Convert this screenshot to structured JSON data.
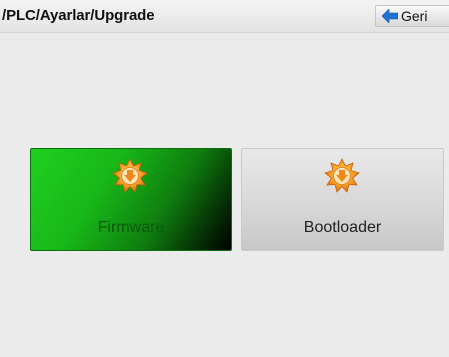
{
  "header": {
    "breadcrumb": "/PLC/Ayarlar/Upgrade",
    "back_label": "Geri",
    "back_icon": "arrow-left-icon"
  },
  "tiles": [
    {
      "label": "Firmware",
      "icon": "upgrade-star-icon",
      "state": "selected"
    },
    {
      "label": "Bootloader",
      "icon": "upgrade-star-icon",
      "state": "normal"
    }
  ],
  "colors": {
    "selected_tile": "#1fd01f",
    "back_arrow": "#1e73d8",
    "icon_orange": "#f28c1e"
  }
}
